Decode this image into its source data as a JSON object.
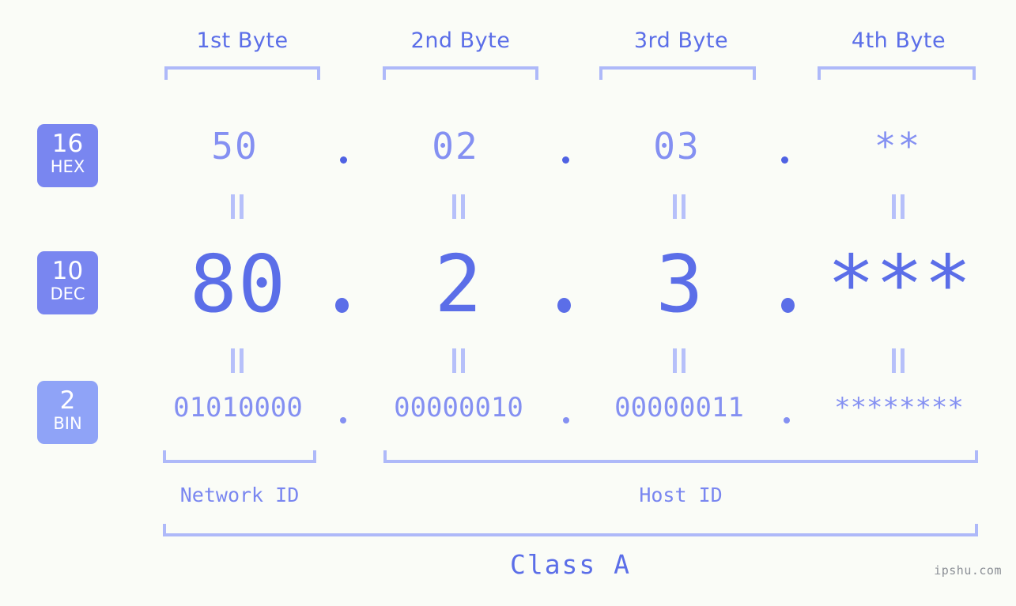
{
  "page": {
    "background_color": "#fafcf7",
    "accent_color": "#5b6ee8",
    "accent_light_color": "#8490f2",
    "bracket_color": "#aeb9f9",
    "watermark": "ipshu.com"
  },
  "byte_headers": [
    {
      "label": "1st Byte"
    },
    {
      "label": "2nd Byte"
    },
    {
      "label": "3rd Byte"
    },
    {
      "label": "4th Byte"
    }
  ],
  "bases": [
    {
      "number": "16",
      "name": "HEX"
    },
    {
      "number": "10",
      "name": "DEC"
    },
    {
      "number": "2",
      "name": "BIN"
    }
  ],
  "rows": {
    "hex": {
      "base": "16",
      "base_name": "HEX",
      "values": [
        "50",
        "02",
        "03",
        "**"
      ]
    },
    "dec": {
      "base": "10",
      "base_name": "DEC",
      "values": [
        "80",
        "2",
        "3",
        "***"
      ]
    },
    "bin": {
      "base": "2",
      "base_name": "BIN",
      "values": [
        "01010000",
        "00000010",
        "00000011",
        "********"
      ]
    }
  },
  "separators": {
    "symbol": "."
  },
  "equals": {
    "symbol": "="
  },
  "id_labels": {
    "network": "Network ID",
    "host": "Host ID"
  },
  "class_label": "Class A"
}
